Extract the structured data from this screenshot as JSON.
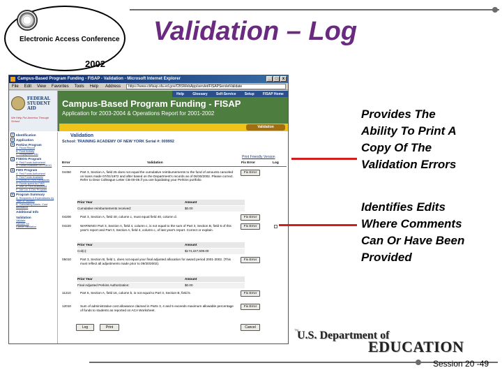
{
  "slide": {
    "conference_logo": {
      "name": "Electronic Access Conference",
      "year": "2002"
    },
    "title": "Validation – Log",
    "session": "Session 20 -49",
    "footer_logo": {
      "line1": "U.S. Department of",
      "line2": "EDUCATION",
      "small": "TM"
    }
  },
  "callouts": [
    {
      "lines": [
        "Provides The",
        "Ability To Print A",
        "Copy Of The",
        "Validation Errors"
      ]
    },
    {
      "lines": [
        "Identifies Edits",
        "Where Comments",
        "Can Or Have Been",
        "Provided"
      ]
    }
  ],
  "browser": {
    "window_title": "Campus-Based Program Funding - FISAP - Validation - Microsoft Internet Explorer",
    "menu": [
      "File",
      "Edit",
      "View",
      "Favorites",
      "Tools",
      "Help"
    ],
    "address_label": "Address",
    "address": "https://www.cbfisap.sfa.ed.gov/CBSWebApp/servlet/FISAPServletValidate",
    "window_buttons": [
      "_",
      "□",
      "x"
    ]
  },
  "site": {
    "logo_lines": [
      "FEDERAL",
      "STUDENT AID"
    ],
    "logo_tagline": "We Help Put America Through School",
    "nav": [
      "Help",
      "Glossary",
      "Self-Service",
      "Setup",
      "FISAP Home"
    ],
    "title": "Campus-Based Program Funding - FISAP",
    "subtitle": "Application for 2003-2004 & Operations Report for 2001-2002",
    "active_tab": "Validation"
  },
  "left_nav": [
    {
      "num": "1",
      "label": "Identification",
      "subs": []
    },
    {
      "num": "2",
      "label": "Application",
      "subs": []
    },
    {
      "num": "3",
      "label": "Perkins Program",
      "subs": [
        "A. Fiscal Report",
        "B. Fund Activity",
        "C. Repayment Info"
      ]
    },
    {
      "num": "4",
      "label": "FSEOG Program",
      "subs": [
        "A. Fed Funds Authorized",
        "B. Funds Available for FSEOG"
      ]
    },
    {
      "num": "5",
      "label": "FWS Program",
      "subs": [
        "A. Fed Funds Authorized",
        "B. Fed Funds Available",
        "C. Funds to FWS Recipients",
        "D. Funds spent for FWS",
        "E. Use of FWS Authorized",
        "F. Job Loc & Dev Program"
      ]
    },
    {
      "num": "6",
      "label": "Program Summary",
      "subs": [
        "A. Recipients & Expenditures by Type of Student",
        "B. Calculating Admin. Cost Allowance"
      ]
    },
    {
      "num": "",
      "label": "Additional Info",
      "subs": []
    },
    {
      "num": "",
      "label": "Validation",
      "subs": [
        "Validate",
        "Validate All",
        "Cancel Validation"
      ]
    }
  ],
  "content": {
    "heading": "Validation",
    "school_line": "School: TRAINING ACADEMY OF NEW YORK   Serial #: 009992",
    "print_link": "Print Friendly Version",
    "columns": {
      "error": "Error",
      "validation": "Validation",
      "fix": "Fix Error",
      "log": "Log"
    },
    "sub_headers": {
      "prior_year": "Prior Year",
      "amount": "Amount"
    },
    "fix_label": "Fix Error",
    "rows": [
      {
        "code": "04450",
        "message": "Part 3, Section A, field 25 does not equal the cumulative reimbursements to the fund of amounts canceled on loans made 07/01/1972 and after based on the Department's records as of 06/30/2002. Please correct. Refer to Dear Colleague Letter CB-00-05 if you are liquidating your Perkins portfolio.",
        "sub_label": "Cumulative reimbursements received:",
        "sub_amount": "$0.00",
        "log": false
      },
      {
        "code": "04200",
        "message": "Part 3, Section A, field 40, column c, must equal field 40, column d.",
        "log": false
      },
      {
        "code": "04220",
        "message": "WARNING! Part 3, Section A, field 4, column c, is not equal to the sum of Part 3, Section B, field 5 of this year's report and Part 3, Section A, field 4, column c, of last year's report. Correct or explain.",
        "sub_label": "Col(c):",
        "sub_amount": "$174,227,509.00",
        "log": true
      },
      {
        "code": "05010",
        "message": "Part 3, Section B, field 1, does not equal your final adjusted allocation for award period 2001-2002. (This must reflect all adjustments made prior to 09/30/2002).",
        "sub_label": "Final Adjusted Perkins Authorization:",
        "sub_amount": "$0.00",
        "log": false
      },
      {
        "code": "11210",
        "message": "Part 6, Section A, field 16, column b, is not equal to Part 3, Section B, field 5.",
        "log": false
      },
      {
        "code": "12010",
        "message": "Sum of administrative cost allowance claimed in Parts 3, 4 and 5 exceeds maximum allowable percentage of funds to students as reported on ACA Worksheet.",
        "log": false
      }
    ],
    "buttons": {
      "log": "Log",
      "print": "Print",
      "cancel": "Cancel"
    }
  }
}
